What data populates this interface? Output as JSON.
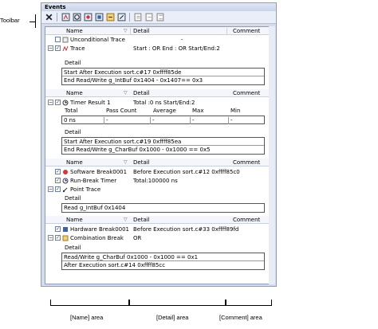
{
  "annotation": {
    "toolbar": "Toolbar",
    "name_area": "[Name] area",
    "detail_area": "[Detail] area",
    "comment_area": "[Comment] area"
  },
  "window": {
    "title": "Events"
  },
  "columns": {
    "name": "Name",
    "detail": "Detail",
    "comment": "Comment"
  },
  "events": {
    "unconditional": {
      "name": "Unconditional Trace",
      "detail": "-"
    },
    "trace": {
      "name": "Trace",
      "detail": "Start : OR End : OR Start/End:2"
    },
    "trace_detail_label": "Detail",
    "trace_detail_lines": [
      "Start After Execution sort.c#17 0xffff85de",
      "End Read/Write g_IntBuf 0x1404 - 0x1407== 0x3"
    ],
    "timer": {
      "name": "Timer Result 1",
      "detail": "Total :0 ns   Start/End:2"
    },
    "timer_stats": {
      "headers": [
        "Total",
        "Pass Count",
        "Average",
        "Max",
        "Min"
      ],
      "values": [
        "0 ns",
        "-",
        "-",
        "-",
        "-"
      ]
    },
    "timer_detail_label": "Detail",
    "timer_detail_lines": [
      "Start After Execution sort.c#19 0xffff85ea",
      "End Read/Write g_CharBuf 0x1000 - 0x1000 == 0x5"
    ],
    "sw_break": {
      "name": "Software Break0001",
      "detail": "Before Execution sort.c#12 0xffff85c0"
    },
    "run_break": {
      "name": "Run-Break Timer",
      "detail": "Total:100000 ns"
    },
    "point_trace": {
      "name": "Point Trace"
    },
    "point_detail_label": "Detail",
    "point_detail_lines": [
      "Read g_IntBuf 0x1404"
    ],
    "hw_break": {
      "name": "Hardware Break0001",
      "detail": "Before Execution sort.c#33 0xffff89fd"
    },
    "combo_break": {
      "name": "Combination Break",
      "detail": "OR"
    },
    "combo_detail_label": "Detail",
    "combo_detail_lines": [
      "Read/Write g_CharBuf 0x1000 - 0x1000 == 0x1",
      "After Execution sort.c#14 0xffff85cc"
    ]
  }
}
